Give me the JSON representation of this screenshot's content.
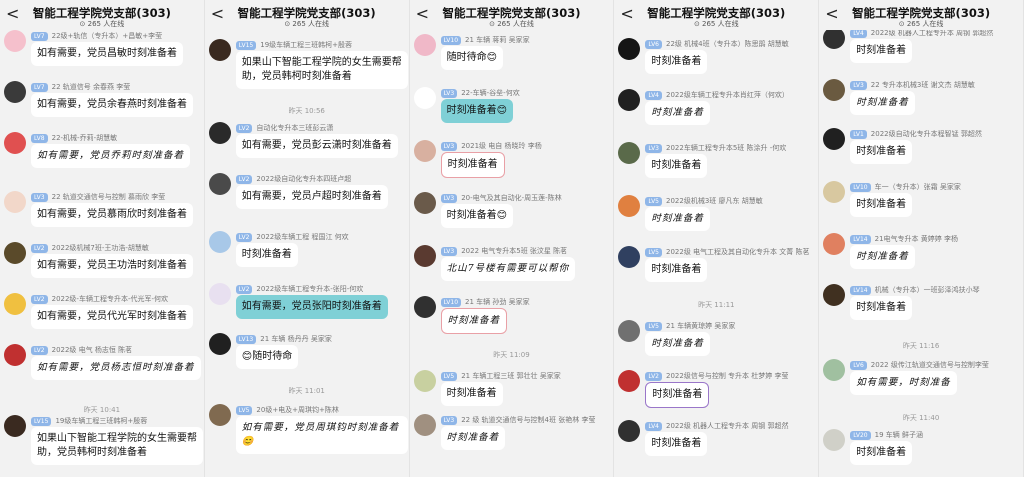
{
  "chat": {
    "back_glyph": "<",
    "title": "智能工程学院党支部(303)",
    "online": "⊙ 265 人在线"
  },
  "panels": [
    {
      "messages": [
        {
          "lv": "LV7",
          "sender": "22级+轨信（专升本）+昌敏+李莹",
          "text": "如有需要，党员昌敏时刻准备着",
          "color": "#f5c0cc"
        },
        {
          "lv": "LV7",
          "sender": "22 轨道信号 余春燕 李莹",
          "text": "如有需要，党员余春燕时刻准备着",
          "color": "#3a3a3a"
        },
        {
          "lv": "LV8",
          "sender": "22-机械-乔莉-胡慧敏",
          "text": "如有需要，党员乔莉时刻准备着",
          "color": "#e05050",
          "hand": true
        },
        {
          "lv": "LV3",
          "sender": "22 轨道交通信号与控制 慕雨欣 李莹",
          "text": "如有需要，党员慕雨欣时刻准备着",
          "color": "#f2d7c9"
        },
        {
          "lv": "LV2",
          "sender": "2022级机械7班-王功浩-胡慧敏",
          "text": "如有需要，党员王功浩时刻准备着",
          "color": "#5a4a2a"
        },
        {
          "lv": "LV2",
          "sender": "2022级-车辆工程专升本-代光军-何欢",
          "text": "如有需要，党员代光军时刻准备着",
          "color": "#f0c040"
        },
        {
          "lv": "LV2",
          "sender": "2022级 电气 杨志恒 陈茗",
          "text": "如有需要，党员杨志恒时刻准备着",
          "color": "#c03030",
          "hand": true
        },
        {
          "lv": "LV15",
          "sender": "19级车辆工程三班韩柯+殷蓉",
          "text": "如果山下智能工程学院的女生需要帮助，党员韩柯时刻准备着",
          "color": "#3a2a20",
          "wrap": true
        }
      ],
      "times": [
        "昨天 10:41"
      ]
    },
    {
      "messages": [
        {
          "lv": "LV15",
          "sender": "19级车辆工程三班韩柯+殷蓉",
          "text": "如果山下智能工程学院的女生需要帮助，党员韩柯时刻准备着",
          "color": "#3a2a20",
          "wrap": true
        },
        {
          "lv": "LV2",
          "sender": "自动化专升本三班彭云潇",
          "text": "如有需要，党员彭云潇时刻准备着",
          "color": "#2a2a2a"
        },
        {
          "lv": "LV2",
          "sender": "2022级自动化专升本四班卢超",
          "text": "如有需要，党员卢超时刻准备着",
          "color": "#4a4a4a"
        },
        {
          "lv": "LV2",
          "sender": "2022级车辆工程 程国江 何欢",
          "text": "时刻准备着",
          "color": "#a8c8e8"
        },
        {
          "lv": "LV2",
          "sender": "2022级车辆工程专升本-张阳-何欢",
          "text": "如有需要，党员张阳时刻准备着",
          "color": "#e8e0f0",
          "hl": true
        },
        {
          "lv": "LV13",
          "sender": "21 车辆 杨丹丹 吴家家",
          "text": "😊随时待命",
          "color": "#202020"
        },
        {
          "lv": "LV5",
          "sender": "20级+电及+周琪钧+陈林",
          "text": "如有需要，党员周琪钧时刻准备着😊",
          "color": "#806a50",
          "hand": true,
          "wrap": true
        }
      ],
      "times": [
        "昨天 10:56",
        "昨天 11:01"
      ]
    },
    {
      "messages": [
        {
          "lv": "LV10",
          "sender": "21 车辆 蒋莉 吴家家",
          "text": "随时待命😊",
          "color": "#f0b8c8"
        },
        {
          "lv": "LV3",
          "sender": "22-车辆-谷垒-何欢",
          "text": "时刻准备着😊",
          "color": "#ffffff",
          "hl": true
        },
        {
          "lv": "LV3",
          "sender": "2021级 电自 杨晓玲 李杨",
          "text": "时刻准备着",
          "color": "#d8b0a0",
          "pink": true
        },
        {
          "lv": "LV3",
          "sender": "20-电气及其自动化-周玉莲-陈林",
          "text": "时刻准备着😊",
          "color": "#6a5a4a"
        },
        {
          "lv": "LV3",
          "sender": "2022 电气专升本5班 张汶星 陈茗",
          "text": "北山7号楼有需要可以帮你",
          "color": "#5a3a30",
          "hand": true
        },
        {
          "lv": "LV10",
          "sender": "21 车辆 孙劲 吴家家",
          "text": "时刻准备着",
          "color": "#303030",
          "pink": true,
          "hand": true
        },
        {
          "lv": "LV5",
          "sender": "21 车辆工程三班 郭壮壮 吴家家",
          "text": "时刻准备着",
          "color": "#c8d0a0"
        },
        {
          "lv": "LV3",
          "sender": "22 级 轨道交通信号与控制4班 张艳林 李莹",
          "text": "时刻准备着",
          "color": "#a09080",
          "hand": true
        }
      ],
      "times": [
        "昨天 11:09"
      ]
    },
    {
      "messages": [
        {
          "lv": "LV6",
          "sender": "22级 机械4班（专升本）陈思鹃 胡慧敏",
          "text": "时刻准备着",
          "color": "#151515"
        },
        {
          "lv": "LV4",
          "sender": "2022级车辆工程专升本肖红萍（何欢）",
          "text": "时刻准备着",
          "color": "#202020",
          "hand": true
        },
        {
          "lv": "LV3",
          "sender": "2022车辆工程专升本5班 陈涂升 -何欢",
          "text": "时刻准备着",
          "color": "#5a6a4a"
        },
        {
          "lv": "LV5",
          "sender": "2022级机械3班 廖凡东 胡慧敏",
          "text": "时刻准备着",
          "color": "#e08040",
          "hand": true
        },
        {
          "lv": "LV5",
          "sender": "2022级 电气工程及其自动化专升本 文菁 陈茗",
          "text": "时刻准备着",
          "color": "#304060"
        },
        {
          "lv": "LV5",
          "sender": "21 车辆黄琼婷 吴家家",
          "text": "时刻准备着",
          "color": "#707070",
          "hand": true
        },
        {
          "lv": "LV2",
          "sender": "2022级信号与控制 专升本 杜梦婷 李莹",
          "text": "时刻准备着",
          "color": "#c03030",
          "purple": true
        },
        {
          "lv": "LV4",
          "sender": "2022级 机器人工程专升本 周钢 郭超然",
          "text": "时刻准备着",
          "color": "#303030"
        }
      ],
      "times": [
        "昨天 11:11"
      ]
    },
    {
      "messages": [
        {
          "lv": "LV4",
          "sender": "2022级 机器人工程专升本 周钢 郭超然",
          "text": "时刻准备着",
          "color": "#303030"
        },
        {
          "lv": "LV3",
          "sender": "22 专升本机械3班 谢文杰 胡慧敏",
          "text": "时刻准备着",
          "color": "#6a5a40",
          "hand": true
        },
        {
          "lv": "LV1",
          "sender": "2022级自动化专升本程智锰 郭超然",
          "text": "时刻准备着",
          "color": "#202020"
        },
        {
          "lv": "LV10",
          "sender": "车一（专升本）张霜 吴家家",
          "text": "时刻准备着",
          "color": "#d8c8a0"
        },
        {
          "lv": "LV14",
          "sender": "21电气专升本 黄婷婷 李杨",
          "text": "时刻准备着",
          "color": "#e08060",
          "hand": true
        },
        {
          "lv": "LV14",
          "sender": "机械（专升本）一班彭泽鸿扶小琴",
          "text": "时刻准备着",
          "color": "#403020"
        },
        {
          "lv": "LV6",
          "sender": "2022 级传江轨道交通信号与控制李莹",
          "text": "如有需要，时刻准备",
          "color": "#a0c0a0",
          "hand": true
        },
        {
          "lv": "LV20",
          "sender": "19 车辆 鲜子涵",
          "text": "时刻准备着",
          "color": "#d0d0c8"
        }
      ],
      "times": [
        "昨天 11:16",
        "昨天 11:40"
      ]
    }
  ]
}
